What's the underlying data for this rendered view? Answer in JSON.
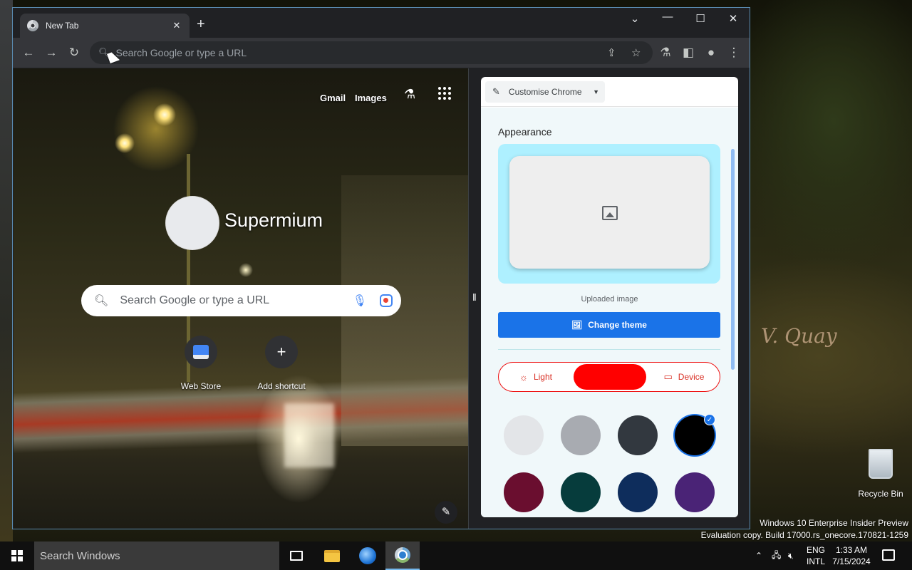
{
  "browser": {
    "tab_title": "New Tab",
    "omnibox_placeholder": "Search Google or type a URL"
  },
  "ntp": {
    "links": [
      "Gmail",
      "Images"
    ],
    "logo_text": "Supermium",
    "search_placeholder": "Search Google or type a URL",
    "shortcuts": [
      {
        "label": "Web Store",
        "icon": "web-store-icon"
      },
      {
        "label": "Add shortcut",
        "icon": "plus-icon"
      }
    ]
  },
  "panel": {
    "header_label": "Customise Chrome",
    "section_title": "Appearance",
    "preview_caption": "Uploaded image",
    "change_theme_label": "Change theme",
    "modes": {
      "light": "Light",
      "dark": "",
      "device": "Device"
    },
    "selected_mode": "dark",
    "accent_color": "#1a73e8",
    "swatches": [
      {
        "color": "#e3e5e8",
        "selected": false
      },
      {
        "color": "#a8abb1",
        "selected": false
      },
      {
        "color": "#32383f",
        "selected": false
      },
      {
        "color": "#000000",
        "selected": true
      },
      {
        "color": "#6a0e2f",
        "selected": false
      },
      {
        "color": "#063c3c",
        "selected": false
      },
      {
        "color": "#0e2d5c",
        "selected": false
      },
      {
        "color": "#4a2376",
        "selected": false
      }
    ]
  },
  "desktop": {
    "recycle_bin_label": "Recycle Bin",
    "watermark_line1": "Windows 10 Enterprise Insider Preview",
    "watermark_line2": "Evaluation copy. Build 17000.rs_onecore.170821-1259",
    "shop_sign": "V. Quay"
  },
  "taskbar": {
    "search_placeholder": "Search Windows",
    "lang_line1": "ENG",
    "lang_line2": "INTL",
    "time": "1:33 AM",
    "date": "7/15/2024"
  }
}
